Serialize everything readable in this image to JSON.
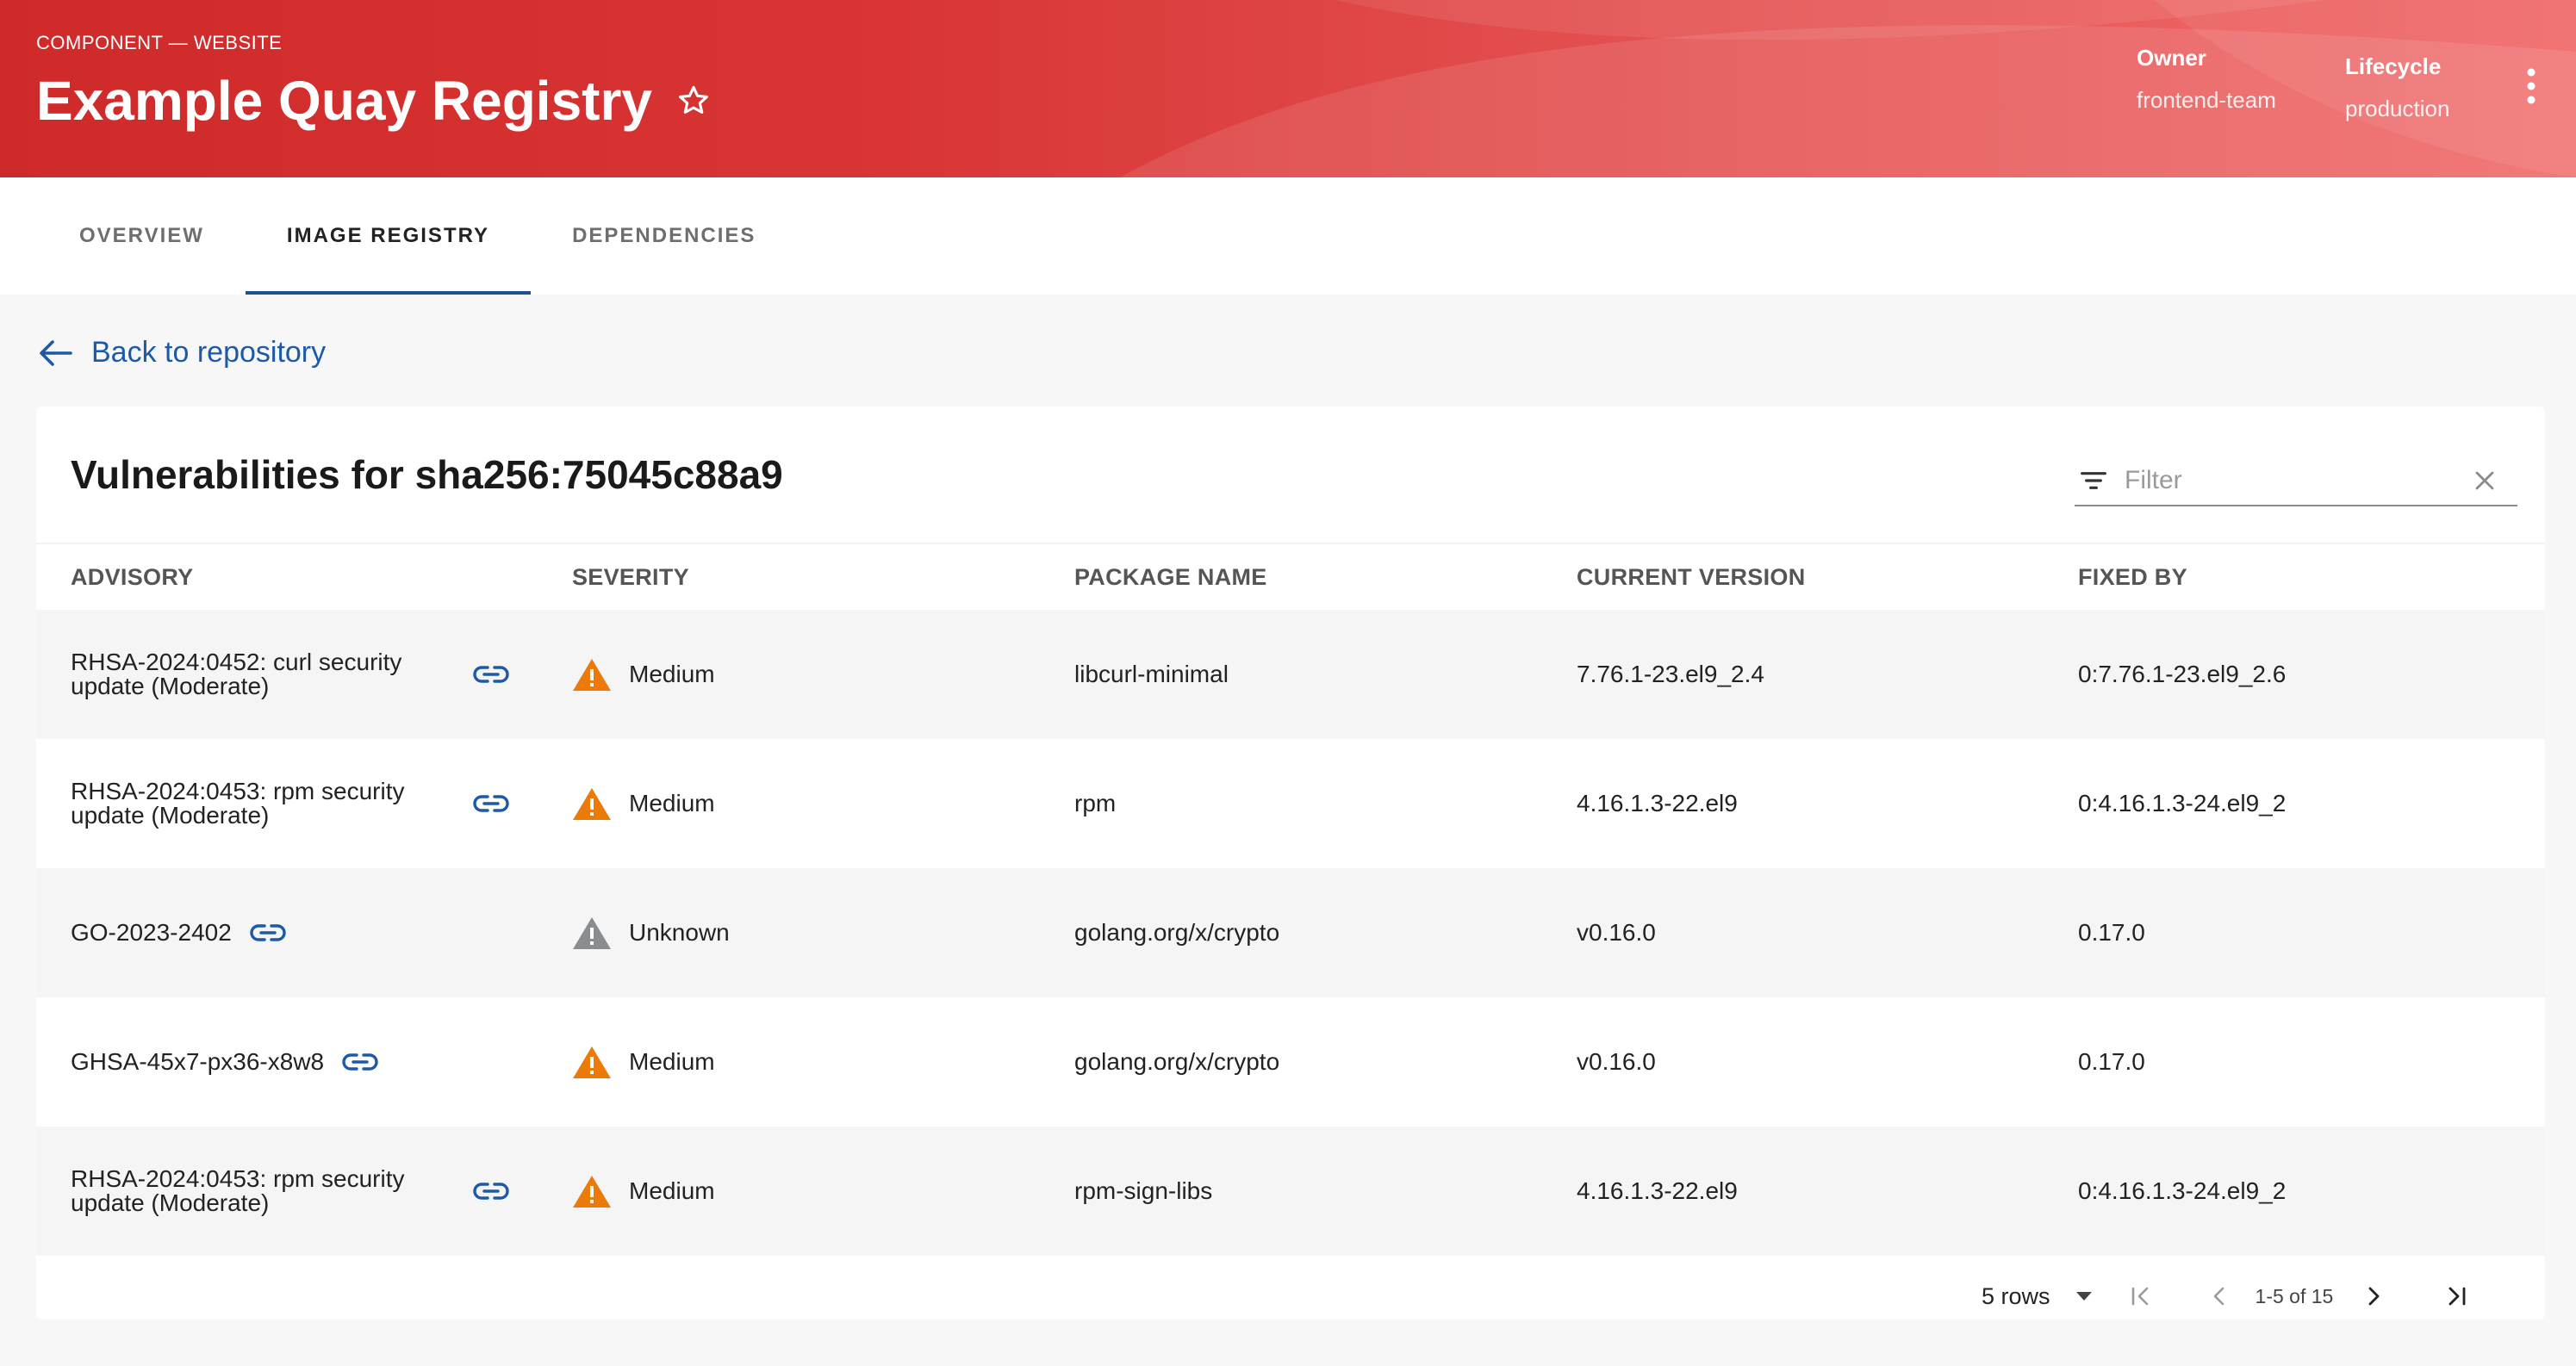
{
  "header": {
    "kicker": "COMPONENT — WEBSITE",
    "title": "Example Quay Registry",
    "owner_label": "Owner",
    "owner_value": "frontend-team",
    "lifecycle_label": "Lifecycle",
    "lifecycle_value": "production",
    "colors": {
      "primary": "#d32f2f",
      "accent": "#f06a6a"
    }
  },
  "tabs": [
    {
      "label": "OVERVIEW",
      "active": false
    },
    {
      "label": "IMAGE REGISTRY",
      "active": true
    },
    {
      "label": "DEPENDENCIES",
      "active": false
    }
  ],
  "back_link": "Back to repository",
  "card": {
    "title": "Vulnerabilities for sha256:75045c88a9",
    "filter_placeholder": "Filter",
    "columns": [
      "ADVISORY",
      "SEVERITY",
      "PACKAGE NAME",
      "CURRENT VERSION",
      "FIXED BY"
    ],
    "rows": [
      {
        "advisory": "RHSA-2024:0452: curl security update (Moderate)",
        "severity": "Medium",
        "package": "libcurl-minimal",
        "current": "7.76.1-23.el9_2.4",
        "fixed": "0:7.76.1-23.el9_2.6"
      },
      {
        "advisory": "RHSA-2024:0453: rpm security update (Moderate)",
        "severity": "Medium",
        "package": "rpm",
        "current": "4.16.1.3-22.el9",
        "fixed": "0:4.16.1.3-24.el9_2"
      },
      {
        "advisory": "GO-2023-2402",
        "severity": "Unknown",
        "package": "golang.org/x/crypto",
        "current": "v0.16.0",
        "fixed": "0.17.0"
      },
      {
        "advisory": "GHSA-45x7-px36-x8w8",
        "severity": "Medium",
        "package": "golang.org/x/crypto",
        "current": "v0.16.0",
        "fixed": "0.17.0"
      },
      {
        "advisory": "RHSA-2024:0453: rpm security update (Moderate)",
        "severity": "Medium",
        "package": "rpm-sign-libs",
        "current": "4.16.1.3-22.el9",
        "fixed": "0:4.16.1.3-24.el9_2"
      }
    ],
    "severity_colors": {
      "Medium": "#ec7a08",
      "Unknown": "#8a8d90"
    }
  },
  "pagination": {
    "rows_per_page": "5 rows",
    "range": "1-5 of 15"
  }
}
